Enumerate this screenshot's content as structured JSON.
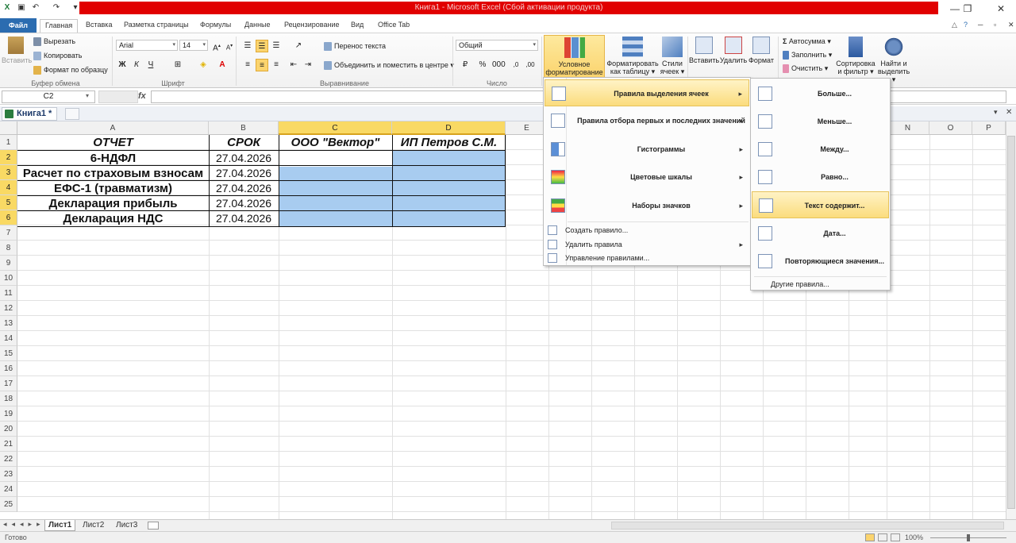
{
  "window": {
    "title": "Книга1 - Microsoft Excel (Сбой активации продукта)",
    "title_bar_color": "#e10000"
  },
  "tabs": [
    "Файл",
    "Главная",
    "Вставка",
    "Разметка страницы",
    "Формулы",
    "Данные",
    "Рецензирование",
    "Вид",
    "Office Tab"
  ],
  "ribbon": {
    "paste": "Вставить",
    "cut": "Вырезать",
    "copy": "Копировать",
    "format_painter": "Формат по образцу",
    "clipboard_label": "Буфер обмена",
    "font_name": "Arial",
    "font_size": "14",
    "bold": "Ж",
    "italic": "К",
    "underline": "Ч",
    "font_label": "Шрифт",
    "wrap_text": "Перенос текста",
    "merge_center": "Объединить и поместить в центре",
    "alignment_label": "Выравнивание",
    "number_format": "Общий",
    "number_label": "Число",
    "conditional_formatting": [
      "Условное",
      "форматирование"
    ],
    "format_as_table": [
      "Форматировать",
      "как таблицу"
    ],
    "cell_styles": [
      "Стили",
      "ячеек"
    ],
    "insert": "Вставить",
    "delete": "Удалить",
    "format": "Формат",
    "autosum": "Автосумма",
    "fill": "Заполнить",
    "clear": "Очистить",
    "sort_filter": [
      "Сортировка",
      "и фильтр"
    ],
    "find_select": [
      "Найти и",
      "выделить"
    ]
  },
  "formula_bar": {
    "name_box": "C2",
    "fx": "fx",
    "formula": ""
  },
  "workbook_tab": "Книга1 *",
  "columns": [
    "A",
    "B",
    "C",
    "D",
    "E",
    "F",
    "G",
    "H",
    "I",
    "J",
    "K",
    "L",
    "M",
    "N",
    "O",
    "P"
  ],
  "rows": [
    "1",
    "2",
    "3",
    "4",
    "5",
    "6",
    "7",
    "8",
    "9",
    "10",
    "11",
    "12",
    "13",
    "14",
    "15",
    "16",
    "17",
    "18",
    "19",
    "20",
    "21",
    "22",
    "23",
    "24",
    "25"
  ],
  "table": {
    "headers": [
      "ОТЧЕТ",
      "СРОК",
      "ООО \"Вектор\"",
      "ИП Петров С.М."
    ],
    "rows": [
      [
        "6-НДФЛ",
        "27.04.2026"
      ],
      [
        "Расчет по страховым взносам",
        "27.04.2026"
      ],
      [
        "ЕФС-1 (травматизм)",
        "27.04.2026"
      ],
      [
        "Декларация прибыль",
        "27.04.2026"
      ],
      [
        "Декларация НДС",
        "27.04.2026"
      ]
    ]
  },
  "cf_menu": {
    "items": [
      "Правила выделения ячеек",
      "Правила отбора первых и последних значений",
      "Гистограммы",
      "Цветовые шкалы",
      "Наборы значков"
    ],
    "small_items": [
      "Создать правило...",
      "Удалить правила",
      "Управление правилами..."
    ]
  },
  "submenu": {
    "items": [
      "Больше...",
      "Меньше...",
      "Между...",
      "Равно...",
      "Текст содержит...",
      "Дата...",
      "Повторяющиеся значения..."
    ],
    "other": "Другие правила..."
  },
  "sheets": [
    "Лист1",
    "Лист2",
    "Лист3"
  ],
  "status": {
    "ready": "Готово",
    "zoom": "100%"
  },
  "colors": {
    "selection": "#a8ccf0",
    "accent": "#2b6cb0",
    "highlight": "#fbd46e"
  }
}
